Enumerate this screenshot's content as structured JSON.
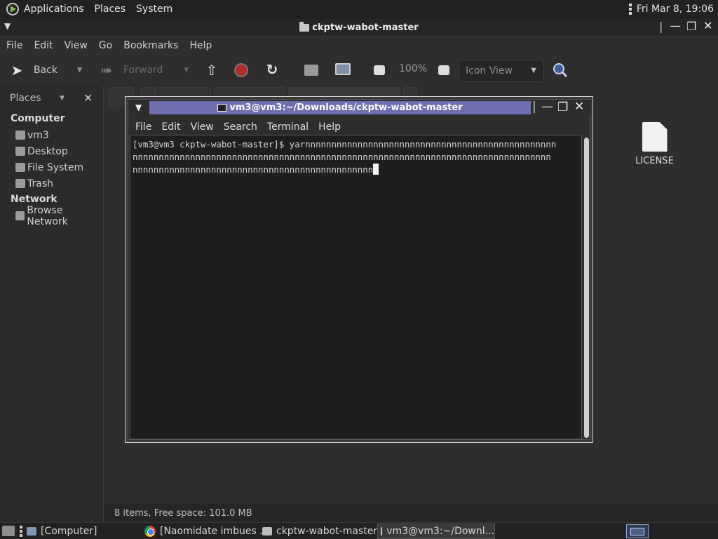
{
  "top_panel": {
    "menus": [
      "Applications",
      "Places",
      "System"
    ],
    "clock": "Fri Mar  8, 19:06"
  },
  "file_manager": {
    "title": "ckptw-wabot-master",
    "menubar": [
      "File",
      "Edit",
      "View",
      "Go",
      "Bookmarks",
      "Help"
    ],
    "toolbar": {
      "back": "Back",
      "forward": "Forward",
      "zoom": "100%",
      "view_mode": "Icon View"
    },
    "sidebar": {
      "header": "Places",
      "sections": [
        {
          "title": "Computer",
          "items": [
            "vm3",
            "Desktop",
            "File System",
            "Trash"
          ]
        },
        {
          "title": "Network",
          "items": [
            "Browse Network"
          ]
        }
      ]
    },
    "files": [
      {
        "name": "LICENSE",
        "icon": "text-file-icon"
      }
    ],
    "status": "8 items, Free space: 101.0 MB"
  },
  "terminal": {
    "title": "vm3@vm3:~/Downloads/ckptw-wabot-master",
    "menubar": [
      "File",
      "Edit",
      "View",
      "Search",
      "Terminal",
      "Help"
    ],
    "lines": [
      "[vm3@vm3 ckptw-wabot-master]$ yarnnnnnnnnnnnnnnnnnnnnnnnnnnnnnnnnnnnnnnnnnnnnnnnn",
      "nnnnnnnnnnnnnnnnnnnnnnnnnnnnnnnnnnnnnnnnnnnnnnnnnnnnnnnnnnnnnnnnnnnnnnnnnnnnnnnn",
      "nnnnnnnnnnnnnnnnnnnnnnnnnnnnnnnnnnnnnnnnnnnnnn"
    ]
  },
  "taskbar": {
    "tasks": [
      "[Computer]",
      "[Naomidate imbues ...",
      "ckptw-wabot-master",
      "vm3@vm3:~/Downl..."
    ]
  }
}
